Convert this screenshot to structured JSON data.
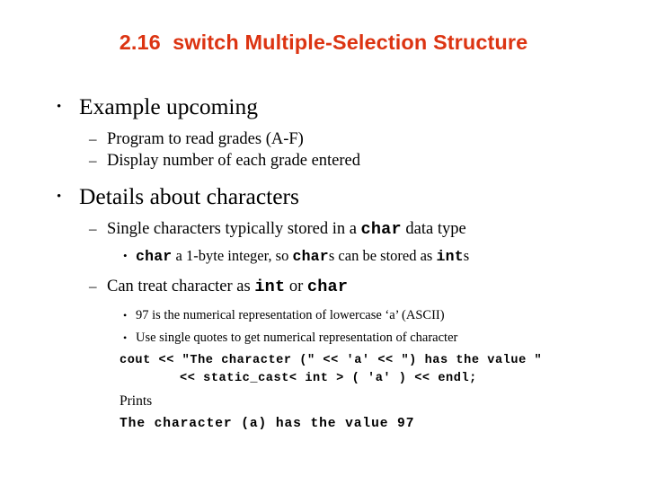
{
  "slide": {
    "title": "2.16  switch Multiple-Selection Structure",
    "title_color": "#DC3412",
    "background_color": "#FFFFFF",
    "text_color": "#000000"
  },
  "bullets": {
    "b1": {
      "marker": "•",
      "text": "Example upcoming"
    },
    "b2": {
      "marker": "–",
      "text": "Program to read grades (A-F)"
    },
    "b3": {
      "marker": "–",
      "text": "Display number of each grade entered"
    },
    "b4": {
      "marker": "•",
      "text": "Details about characters"
    },
    "b5": {
      "marker": "–",
      "seg1": "Single characters typically stored in a ",
      "code1": "char",
      "seg2": " data type"
    },
    "b6": {
      "marker": "•",
      "code1": "char",
      "seg1": " a 1-byte integer, so ",
      "code2": "char",
      "seg2": "s can be stored as ",
      "code3": "int",
      "seg3": "s"
    },
    "b7": {
      "marker": "–",
      "seg1": "Can treat character as ",
      "code1": "int",
      "seg2": " or ",
      "code2": "char"
    },
    "b8": {
      "marker": "•",
      "text": "97 is the numerical representation of lowercase ‘a’ (ASCII)"
    },
    "b9": {
      "marker": "•",
      "text": "Use single quotes to get numerical representation of character"
    }
  },
  "code": {
    "line1": "cout << \"The character (\" << 'a' << \") has the value \"",
    "line2": "<< static_cast< int > ( 'a' ) << endl;",
    "prints_label": "Prints",
    "output": "The character (a) has the value 97"
  }
}
